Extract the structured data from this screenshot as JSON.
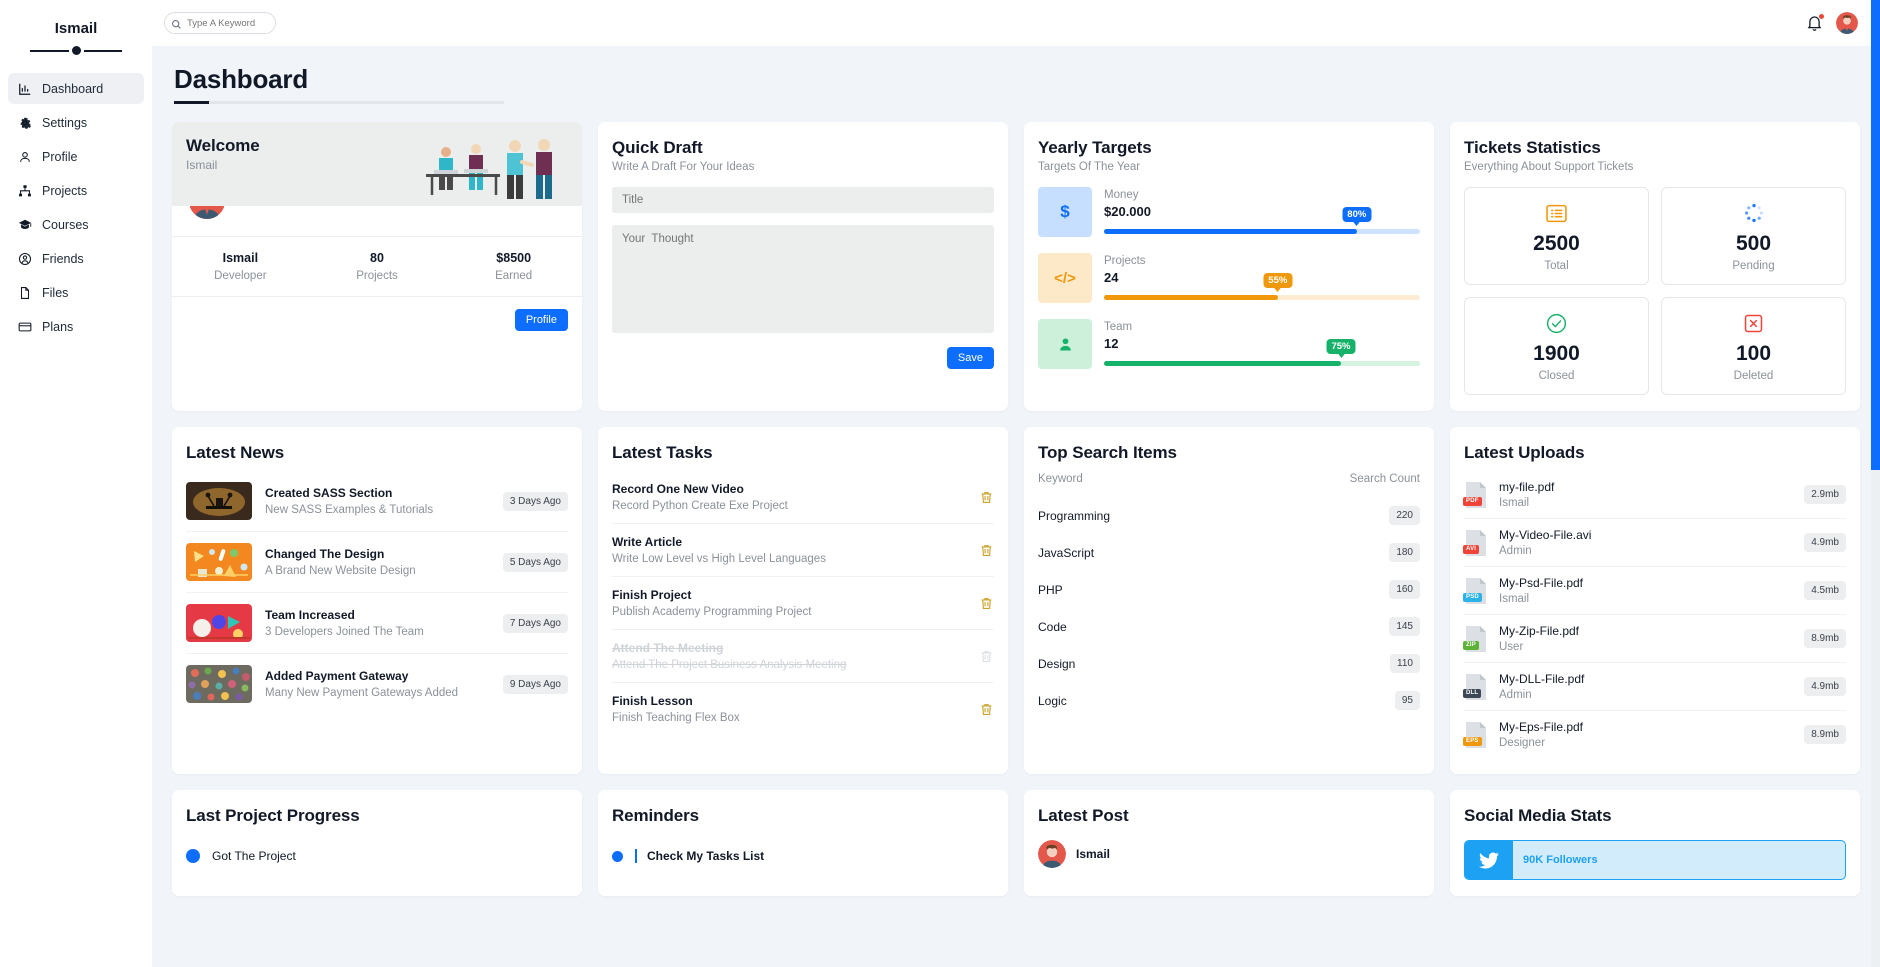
{
  "brand": {
    "name": "Ismail"
  },
  "search": {
    "placeholder": "Type A Keyword",
    "value": ""
  },
  "sidebar": {
    "items": [
      {
        "label": "Dashboard",
        "icon": "chart-bar-icon",
        "active": true
      },
      {
        "label": "Settings",
        "icon": "gear-icon",
        "active": false
      },
      {
        "label": "Profile",
        "icon": "user-icon",
        "active": false
      },
      {
        "label": "Projects",
        "icon": "sitemap-icon",
        "active": false
      },
      {
        "label": "Courses",
        "icon": "graduation-cap-icon",
        "active": false
      },
      {
        "label": "Friends",
        "icon": "user-circle-icon",
        "active": false
      },
      {
        "label": "Files",
        "icon": "file-icon",
        "active": false
      },
      {
        "label": "Plans",
        "icon": "credit-card-icon",
        "active": false
      }
    ]
  },
  "page": {
    "title": "Dashboard"
  },
  "welcome": {
    "title": "Welcome",
    "subtitle": "Ismail",
    "stats": [
      {
        "value": "Ismail",
        "label": "Developer"
      },
      {
        "value": "80",
        "label": "Projects"
      },
      {
        "value": "$8500",
        "label": "Earned"
      }
    ],
    "button": "Profile"
  },
  "quick_draft": {
    "title": "Quick Draft",
    "subtitle": "Write A Draft For Your Ideas",
    "title_placeholder": "Title",
    "title_value": "",
    "body_placeholder": "Your  Thought",
    "body_value": "",
    "save_label": "Save"
  },
  "yearly_targets": {
    "title": "Yearly Targets",
    "subtitle": "Targets Of The Year",
    "items": [
      {
        "label": "Money",
        "value": "$20.000",
        "percent": 80,
        "percent_label": "80%",
        "icon": "dollar-icon",
        "color": "#0d6efd",
        "bg": "#c7dfff",
        "track": "#cfe2ff"
      },
      {
        "label": "Projects",
        "value": "24",
        "percent": 55,
        "percent_label": "55%",
        "icon": "code-icon",
        "color": "#f0980b",
        "bg": "#fde8c8",
        "track": "#fcecd4"
      },
      {
        "label": "Team",
        "value": "12",
        "percent": 75,
        "percent_label": "75%",
        "icon": "users-icon",
        "color": "#17b26a",
        "bg": "#cdf0db",
        "track": "#d6f3e2"
      }
    ]
  },
  "tickets": {
    "title": "Tickets Statistics",
    "subtitle": "Everything About Support Tickets",
    "boxes": [
      {
        "number": "2500",
        "label": "Total",
        "icon": "list-icon",
        "color": "#f0980b"
      },
      {
        "number": "500",
        "label": "Pending",
        "icon": "spinner-icon",
        "color": "#0d6efd"
      },
      {
        "number": "1900",
        "label": "Closed",
        "icon": "check-circle-icon",
        "color": "#17b26a"
      },
      {
        "number": "100",
        "label": "Deleted",
        "icon": "times-square-icon",
        "color": "#f04438"
      }
    ]
  },
  "latest_news": {
    "title": "Latest News",
    "items": [
      {
        "title": "Created SASS Section",
        "desc": "New SASS Examples & Tutorials",
        "time": "3 Days Ago",
        "thumb": "lamp-photo"
      },
      {
        "title": "Changed The Design",
        "desc": "A Brand New Website Design",
        "time": "5 Days Ago",
        "thumb": "orange-tools-photo"
      },
      {
        "title": "Team Increased",
        "desc": "3 Developers Joined The Team",
        "time": "7 Days Ago",
        "thumb": "red-abstract-photo"
      },
      {
        "title": "Added Payment Gateway",
        "desc": "Many New Payment Gateways Added",
        "time": "9 Days Ago",
        "thumb": "colorful-photo"
      }
    ]
  },
  "latest_tasks": {
    "title": "Latest Tasks",
    "items": [
      {
        "title": "Record One New Video",
        "desc": "Record Python Create Exe Project",
        "done": false
      },
      {
        "title": "Write Article",
        "desc": "Write Low Level vs High Level Languages",
        "done": false
      },
      {
        "title": "Finish Project",
        "desc": "Publish Academy Programming Project",
        "done": false
      },
      {
        "title": "Attend The Meeting",
        "desc": "Attend The Project Business Analysis Meeting",
        "done": true
      },
      {
        "title": "Finish Lesson",
        "desc": "Finish Teaching Flex Box",
        "done": false
      }
    ]
  },
  "top_search": {
    "title": "Top Search Items",
    "col_keyword": "Keyword",
    "col_count": "Search Count",
    "rows": [
      {
        "keyword": "Programming",
        "count": "220"
      },
      {
        "keyword": "JavaScript",
        "count": "180"
      },
      {
        "keyword": "PHP",
        "count": "160"
      },
      {
        "keyword": "Code",
        "count": "145"
      },
      {
        "keyword": "Design",
        "count": "110"
      },
      {
        "keyword": "Logic",
        "count": "95"
      }
    ]
  },
  "latest_uploads": {
    "title": "Latest Uploads",
    "items": [
      {
        "name": "my-file.pdf",
        "owner": "Ismail",
        "size": "2.9mb",
        "type": "PDF",
        "color": "#f04438"
      },
      {
        "name": "My-Video-File.avi",
        "owner": "Admin",
        "size": "4.9mb",
        "type": "AVI",
        "color": "#f04438"
      },
      {
        "name": "My-Psd-File.pdf",
        "owner": "Ismail",
        "size": "4.5mb",
        "type": "PSD",
        "color": "#2bb3e8"
      },
      {
        "name": "My-Zip-File.pdf",
        "owner": "User",
        "size": "8.9mb",
        "type": "ZIP",
        "color": "#5cb338"
      },
      {
        "name": "My-DLL-File.pdf",
        "owner": "Admin",
        "size": "4.9mb",
        "type": "DLL",
        "color": "#3c4858"
      },
      {
        "name": "My-Eps-File.pdf",
        "owner": "Designer",
        "size": "8.9mb",
        "type": "EPS",
        "color": "#f0980b"
      }
    ]
  },
  "last_project": {
    "title": "Last Project Progress",
    "steps": [
      {
        "label": "Got The Project",
        "state": "done"
      }
    ]
  },
  "reminders": {
    "title": "Reminders",
    "items": [
      {
        "title": "Check My Tasks List",
        "color": "#0d6efd"
      }
    ]
  },
  "latest_post": {
    "title": "Latest Post",
    "author": "Ismail"
  },
  "social": {
    "title": "Social Media Stats",
    "rows": [
      {
        "network": "twitter",
        "text": "90K Followers",
        "color": "#1da1f2",
        "bg": "#d2ecfb"
      }
    ]
  }
}
